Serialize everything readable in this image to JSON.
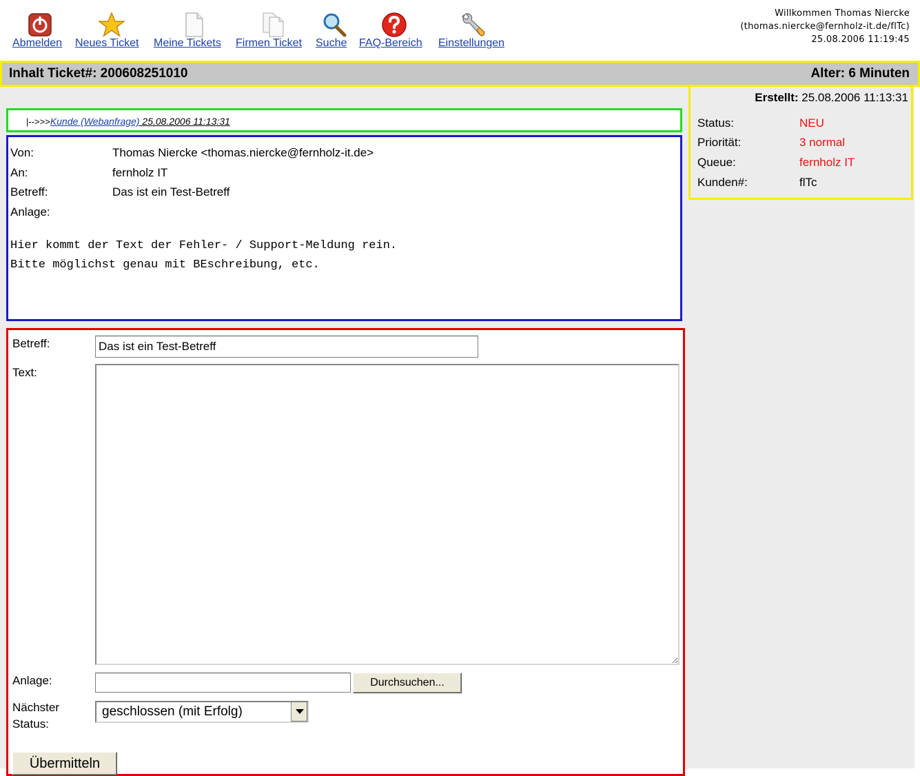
{
  "toolbar": {
    "items": [
      {
        "label": "Abmelden",
        "icon": "power-icon"
      },
      {
        "label": "Neues Ticket",
        "icon": "star-icon"
      },
      {
        "label": "Meine Tickets",
        "icon": "document-icon"
      },
      {
        "label": "Firmen Ticket",
        "icon": "documents-icon"
      },
      {
        "label": "Suche",
        "icon": "search-icon"
      },
      {
        "label": "FAQ-Bereich",
        "icon": "help-icon"
      },
      {
        "label": "Einstellungen",
        "icon": "wrench-icon"
      }
    ]
  },
  "user": {
    "greeting": "Willkommen Thomas Niercke",
    "account": "(thomas.niercke@fernholz-it.de/flTc)",
    "datetime": "25.08.2006 11:19:45"
  },
  "ticket": {
    "title": "Inhalt Ticket#: 200608251010",
    "age": "Alter: 6 Minuten"
  },
  "article": {
    "prefix": "|-->>>",
    "sender_link": "Kunde (Webanfrage)",
    "date": " 25.08.2006 11:13:31"
  },
  "message": {
    "fields": [
      {
        "key": "Von:",
        "value": "Thomas Niercke <thomas.niercke@fernholz-it.de>"
      },
      {
        "key": "An:",
        "value": "fernholz IT"
      },
      {
        "key": "Betreff:",
        "value": "Das ist ein Test-Betreff"
      },
      {
        "key": "Anlage:",
        "value": ""
      }
    ],
    "body": "Hier kommt der Text der Fehler- / Support-Meldung rein.\nBitte möglichst genau mit BEschreibung, etc."
  },
  "reply": {
    "subject_label": "Betreff:",
    "subject_value": "Das ist ein Test-Betreff",
    "text_label": "Text:",
    "text_value": "",
    "attachment_label": "Anlage:",
    "browse_label": "Durchsuchen...",
    "next_status_label_1": "Nächster",
    "next_status_label_2": "Status:",
    "next_status_value": "geschlossen (mit Erfolg)",
    "submit_label": "Übermitteln"
  },
  "info": {
    "created_label": "Erstellt:",
    "created_value": " 25.08.2006 11:13:31",
    "rows": [
      {
        "key": "Status:",
        "value": "NEU"
      },
      {
        "key": "Priorität:",
        "value": "3 normal"
      },
      {
        "key": "Queue:",
        "value": "fernholz IT"
      },
      {
        "key": "Kunden#:",
        "value": "flTc"
      }
    ]
  },
  "colors": {
    "link": "#1a40a8",
    "highlight_value": "#ee1111",
    "header_bar": "#c6c6c6",
    "frame_yellow": "#f5ee00",
    "frame_green": "#1ce01c",
    "frame_blue": "#1a1acc",
    "frame_red": "#e00000"
  }
}
